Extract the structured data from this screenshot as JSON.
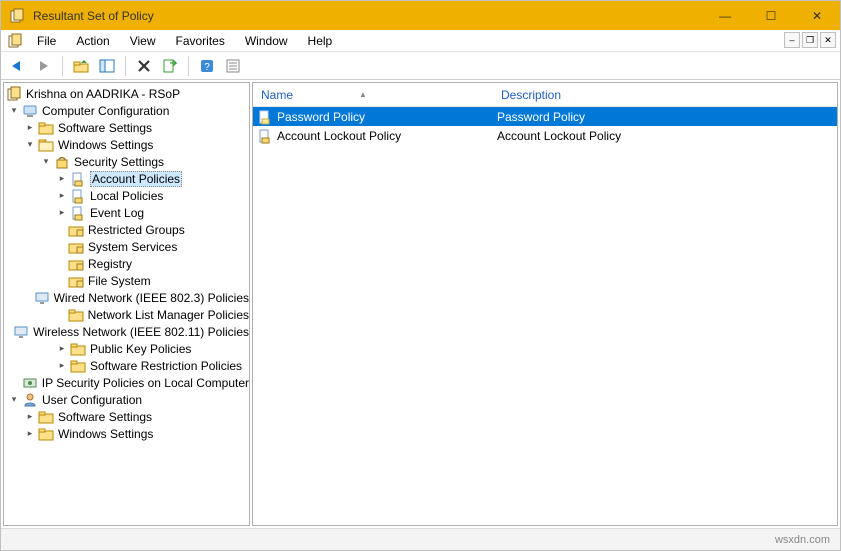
{
  "window": {
    "title": "Resultant Set of Policy"
  },
  "titlebar_buttons": {
    "min": "—",
    "max": "☐",
    "close": "✕"
  },
  "mdi_buttons": {
    "min": "–",
    "restore": "❐",
    "close": "✕"
  },
  "menu": {
    "file": "File",
    "action": "Action",
    "view": "View",
    "favorites": "Favorites",
    "window": "Window",
    "help": "Help"
  },
  "tree": {
    "root": "Krishna on AADRIKA - RSoP",
    "comp": "Computer Configuration",
    "comp_sw": "Software Settings",
    "comp_win": "Windows Settings",
    "sec": "Security Settings",
    "acct": "Account Policies",
    "local": "Local Policies",
    "eventlog": "Event Log",
    "restricted": "Restricted Groups",
    "sysserv": "System Services",
    "registry": "Registry",
    "filesys": "File System",
    "wired": "Wired Network (IEEE 802.3) Policies",
    "netlist": "Network List Manager Policies",
    "wireless": "Wireless Network (IEEE 802.11) Policies",
    "pubkey": "Public Key Policies",
    "swrestrict": "Software Restriction Policies",
    "ipsec": "IP Security Policies on Local Computer",
    "user": "User Configuration",
    "user_sw": "Software Settings",
    "user_win": "Windows Settings"
  },
  "list": {
    "col_name": "Name",
    "col_desc": "Description",
    "rows": [
      {
        "name": "Password Policy",
        "desc": "Password Policy"
      },
      {
        "name": "Account Lockout Policy",
        "desc": "Account Lockout Policy"
      }
    ]
  },
  "footer": {
    "source": "wsxdn.com"
  }
}
